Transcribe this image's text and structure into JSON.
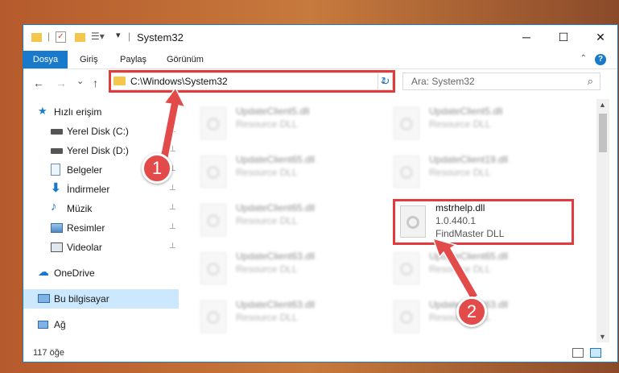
{
  "window": {
    "title": "System32",
    "controls": {
      "minimize": "─",
      "maximize": "☐",
      "close": "✕"
    }
  },
  "ribbon": {
    "tabs": [
      "Dosya",
      "Giriş",
      "Paylaş",
      "Görünüm"
    ],
    "help": "?"
  },
  "nav": {
    "back": "←",
    "forward": "→",
    "recent": "⌄",
    "up": "↑",
    "address": "C:\\Windows\\System32",
    "address_dropdown": "⌄",
    "refresh": "↻",
    "search_placeholder": "Ara: System32"
  },
  "sidebar": {
    "items": [
      {
        "label": "Hızlı erişim",
        "icon": "star-icon",
        "pinned": false
      },
      {
        "label": "Yerel Disk (C:)",
        "icon": "drive-icon",
        "pinned": true
      },
      {
        "label": "Yerel Disk (D:)",
        "icon": "drive-icon",
        "pinned": true
      },
      {
        "label": "Belgeler",
        "icon": "documents-icon",
        "pinned": true
      },
      {
        "label": "İndirmeler",
        "icon": "download-icon",
        "pinned": true
      },
      {
        "label": "Müzik",
        "icon": "music-icon",
        "pinned": true
      },
      {
        "label": "Resimler",
        "icon": "pictures-icon",
        "pinned": true
      },
      {
        "label": "Videolar",
        "icon": "video-icon",
        "pinned": true
      },
      {
        "label": "OneDrive",
        "icon": "cloud-icon",
        "pinned": false
      },
      {
        "label": "Bu bilgisayar",
        "icon": "computer-icon",
        "pinned": false
      },
      {
        "label": "Ağ",
        "icon": "network-icon",
        "pinned": false
      }
    ],
    "pin_glyph": "📌"
  },
  "files": {
    "left": [
      {
        "name": "UpdateClient5.dll",
        "desc": "Resource DLL"
      },
      {
        "name": "UpdateClient65.dll",
        "desc": "Resource DLL"
      },
      {
        "name": "UpdateClient65.dll",
        "desc": "Resource DLL"
      },
      {
        "name": "UpdateClient63.dll",
        "desc": "Resource DLL"
      },
      {
        "name": "UpdateClient63.dll",
        "desc": "Resource DLL"
      }
    ],
    "right": [
      {
        "name": "UpdateClient5.dll",
        "desc": "Resource DLL"
      },
      {
        "name": "UpdateClient19.dll",
        "desc": "Resource DLL"
      },
      {
        "name": "UpdateClient65.dll",
        "desc": "Resource DLL"
      },
      {
        "name": "UpdateClient63.dll",
        "desc": "Resource DLL"
      }
    ],
    "highlighted": {
      "name": "mstrhelp.dll",
      "version": "1.0.440.1",
      "description": "FindMaster DLL"
    }
  },
  "status": {
    "count": "117 öğe"
  },
  "annotations": {
    "step1": "1",
    "step2": "2",
    "color": "#e33b3b"
  }
}
